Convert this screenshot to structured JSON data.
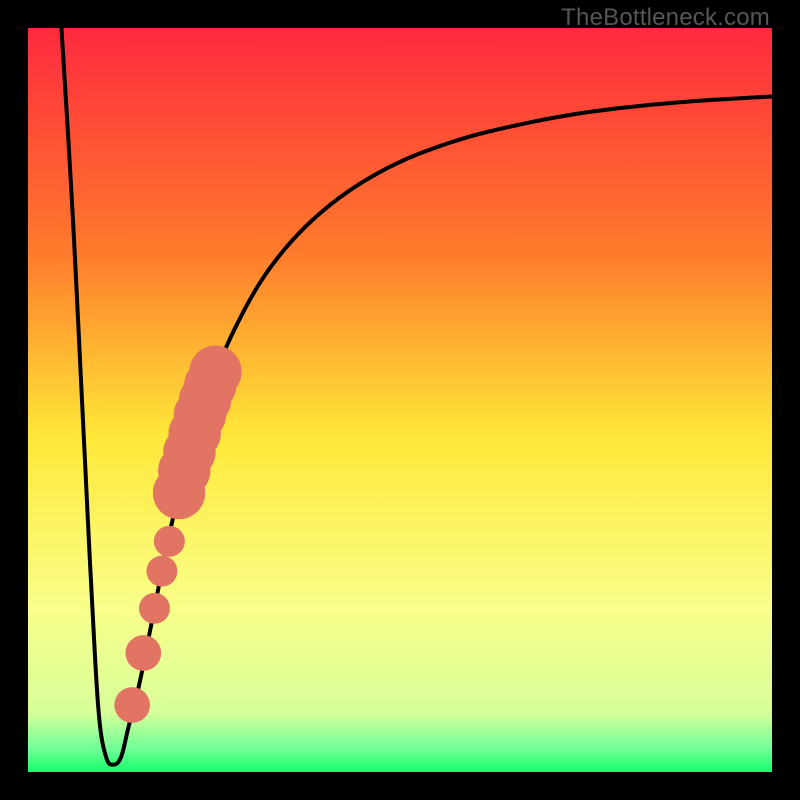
{
  "watermark": "TheBottleneck.com",
  "colors": {
    "frame": "#000000",
    "gradient_top": "#ff2a3e",
    "gradient_mid_top": "#ff9a28",
    "gradient_mid": "#ffe838",
    "gradient_mid_bottom": "#f4ff7a",
    "gradient_bottom": "#16ff6a",
    "curve": "#000000",
    "marker_fill": "#e27464",
    "marker_stroke": "#b85b4d"
  },
  "chart_data": {
    "type": "line",
    "title": "",
    "xlabel": "",
    "ylabel": "",
    "xlim": [
      0,
      100
    ],
    "ylim": [
      0,
      100
    ],
    "gradient_stops": [
      {
        "offset": 0.0,
        "color": "#ff2a3e"
      },
      {
        "offset": 0.3,
        "color": "#ff7a2c"
      },
      {
        "offset": 0.55,
        "color": "#ffe838"
      },
      {
        "offset": 0.78,
        "color": "#f9ff8a"
      },
      {
        "offset": 0.92,
        "color": "#d7ff9a"
      },
      {
        "offset": 0.97,
        "color": "#6cff96"
      },
      {
        "offset": 1.0,
        "color": "#16ff6a"
      }
    ],
    "series": [
      {
        "name": "bottleneck-curve",
        "x": [
          4.5,
          6.0,
          7.5,
          8.5,
          9.5,
          10.5,
          11.5,
          12.5,
          13.5,
          15.0,
          17.0,
          19.0,
          22.0,
          25.0,
          28.0,
          32.0,
          37.0,
          43.0,
          50.0,
          58.0,
          66.0,
          74.0,
          82.0,
          90.0,
          100.0
        ],
        "y": [
          100,
          75,
          45,
          25,
          8,
          2,
          1,
          2,
          6,
          12,
          22,
          32,
          44,
          53,
          60,
          67,
          73,
          78,
          82,
          85,
          87,
          88.5,
          89.5,
          90.2,
          90.8
        ]
      }
    ],
    "markers": [
      {
        "x": 14.0,
        "y": 9,
        "r": 1.5
      },
      {
        "x": 15.5,
        "y": 16,
        "r": 1.5
      },
      {
        "x": 17.0,
        "y": 22,
        "r": 1.3
      },
      {
        "x": 18.0,
        "y": 27,
        "r": 1.3
      },
      {
        "x": 19.0,
        "y": 31,
        "r": 1.3
      },
      {
        "x": 20.3,
        "y": 37.5,
        "r": 2.2
      },
      {
        "x": 21.0,
        "y": 40.5,
        "r": 2.2
      },
      {
        "x": 21.7,
        "y": 43.0,
        "r": 2.2
      },
      {
        "x": 22.4,
        "y": 45.5,
        "r": 2.2
      },
      {
        "x": 23.1,
        "y": 48.0,
        "r": 2.2
      },
      {
        "x": 23.8,
        "y": 50.0,
        "r": 2.2
      },
      {
        "x": 24.5,
        "y": 52.0,
        "r": 2.2
      },
      {
        "x": 25.2,
        "y": 53.8,
        "r": 2.2
      }
    ]
  }
}
